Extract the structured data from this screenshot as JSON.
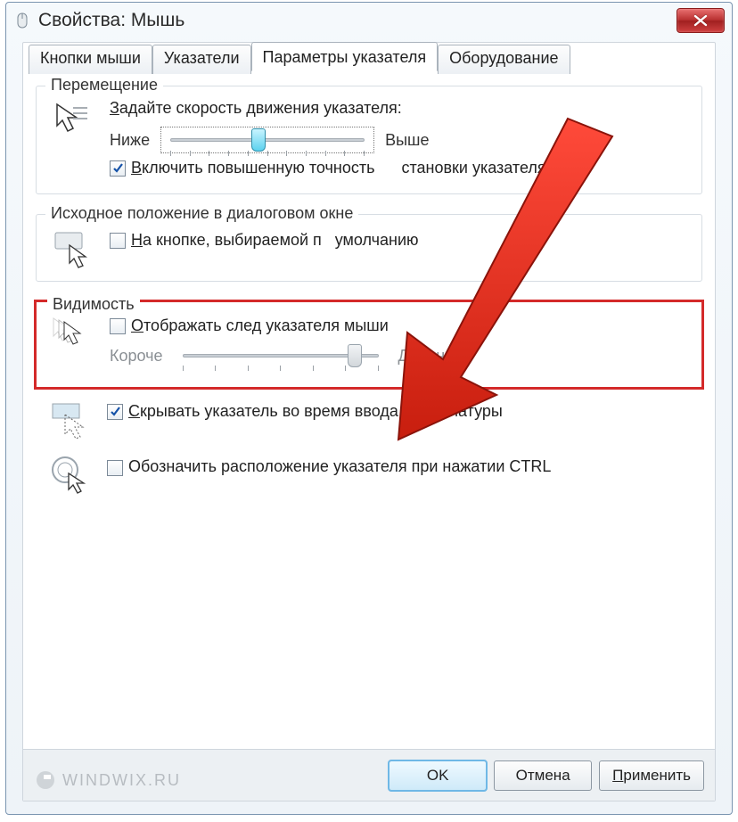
{
  "window": {
    "title": "Свойства: Мышь"
  },
  "tabs": {
    "buttons": "Кнопки мыши",
    "pointers": "Указатели",
    "options": "Параметры указателя",
    "hardware": "Оборудование",
    "active": "options"
  },
  "motion": {
    "legend": "Перемещение",
    "speed_label": "Задайте скорость движения указателя:",
    "slow": "Ниже",
    "fast": "Выше",
    "slider_pos_pct": 45,
    "enhance_label": "Включить повышенную точность установки указателя",
    "enhance_checked": true
  },
  "snap": {
    "legend": "Исходное положение в диалоговом окне",
    "label": "На кнопке, выбираемой по умолчанию",
    "checked": false
  },
  "visibility": {
    "legend": "Видимость",
    "trails_label": "Отображать след указателя мыши",
    "trails_checked": false,
    "short": "Короче",
    "long": "Длиннее",
    "trail_slider_pos_pct": 88,
    "hide_typing_label": "Скрывать указатель во время ввода с клавиатуры",
    "hide_typing_checked": true,
    "ctrl_label": "Обозначить расположение указателя при нажатии CTRL",
    "ctrl_checked": false
  },
  "buttons": {
    "ok": "OK",
    "cancel": "Отмена",
    "apply": "Применить"
  },
  "watermark": "WINDWIX.RU"
}
